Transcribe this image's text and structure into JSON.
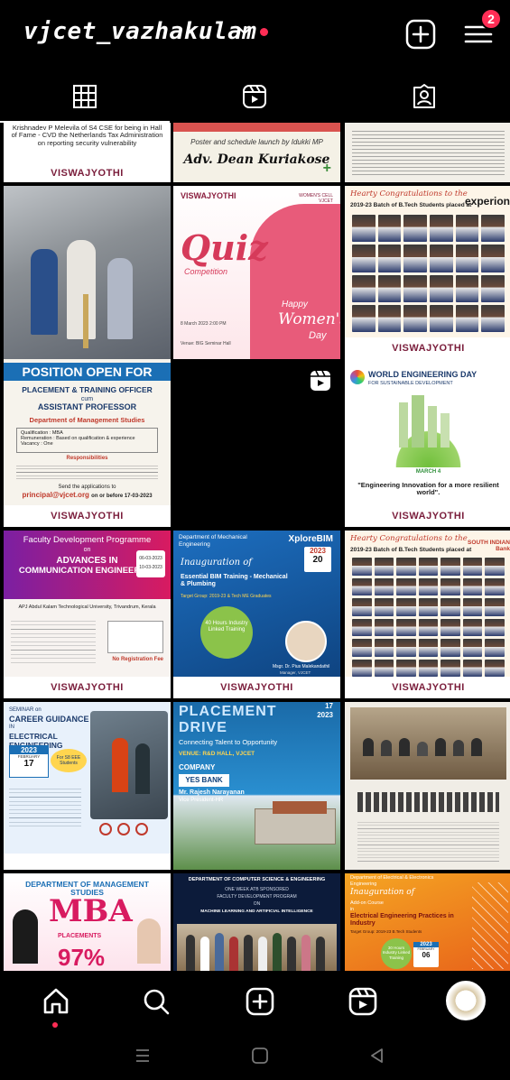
{
  "header": {
    "username": "vjcet_vazhakulam",
    "notification_count": "2",
    "accent": "#ff2d55"
  },
  "tabs": [
    {
      "name": "grid",
      "icon": "grid-icon",
      "active": true
    },
    {
      "name": "reels",
      "icon": "reels-icon",
      "active": false
    },
    {
      "name": "tagged",
      "icon": "tagged-icon",
      "active": false
    }
  ],
  "posts": {
    "p1": {
      "text1": "Krishnadev P Melevila of S4 CSE for being in Hall of Fame - CVD the Netherlands Tax Administration on reporting security vulnerability",
      "logo": "VISWAJYOTHI"
    },
    "p2": {
      "text1": "Poster and schedule launch by Idukki MP",
      "text2": "Adv. Dean Kuriakose"
    },
    "p3": {
      "text1": "Malayalam newspaper clipping"
    },
    "p4": {
      "text1": "Lamp lighting ceremony"
    },
    "p5": {
      "brand": "VISWAJYOTHI",
      "cell": "WOMEN'S CELL VJCET",
      "title": "Quiz",
      "sub": "Competition",
      "happy": "Happy",
      "womens": "Women's",
      "day": "Day",
      "date": "8 March 2023 2:00 PM",
      "venue": "Venue: BIG Seminar Hall"
    },
    "p6": {
      "title": "Hearty Congratulations to the",
      "sub": "2019-23 Batch of B.Tech Students placed at",
      "company": "experion",
      "logo": "VISWAJYOTHI"
    },
    "p7": {
      "title": "POSITION OPEN FOR",
      "role1": "PLACEMENT & TRAINING OFFICER",
      "cum": "cum",
      "role2": "ASSISTANT PROFESSOR",
      "dept": "Department of Management Studies",
      "q1": "Qualification : MBA",
      "q2": "Remuneration : Based on qualification & experience",
      "q3": "Vacancy : One",
      "resp": "Responsibilities",
      "send": "Send the applications to",
      "email": "principal@vjcet.org",
      "before": "on or before 17-03-2023",
      "logo": "VISWAJYOTHI"
    },
    "p8": {
      "text1": ""
    },
    "p9": {
      "title": "WORLD ENGINEERING DAY",
      "sub": "FOR SUSTAINABLE DEVELOPMENT",
      "date": "MARCH 4",
      "quote": "\"Engineering Innovation for a more resilient world\".",
      "logo": "VISWAJYOTHI"
    },
    "p10": {
      "top": "Faculty Development Programme",
      "on": "on",
      "title1": "ADVANCES IN",
      "title2": "COMMUNICATION ENGINEERING",
      "sponsor": "APJ Abdul Kalam Technological University, Trivandrum, Kerala",
      "d1": "06-03-2023",
      "d2": "10-03-2023",
      "fee": "No Registration Fee",
      "logo": "VISWAJYOTHI"
    },
    "p11": {
      "dept": "Department of Mechanical Engineering",
      "inaug": "Inauguration of",
      "course": "Essential BIM Training - Mechanical & Plumbing",
      "target": "Target Group: 2019-23 & Tech ME Graduates",
      "brand": "XploreBIM",
      "year": "2023",
      "date": "20",
      "hours": "40 Hours Industry Linked Training",
      "person": "Msgr. Dr. Pius Malekandathil",
      "role": "Manager, VJCET",
      "logo": "VISWAJYOTHI"
    },
    "p12": {
      "title": "Hearty Congratulations to the",
      "sub": "2019-23 Batch of B.Tech Students placed at",
      "company": "SOUTH INDIAN Bank",
      "logo": "VISWAJYOTHI"
    },
    "p13": {
      "seminar": "SEMINAR on",
      "title1": "CAREER GUIDANCE",
      "in": "IN",
      "title2": "ELECTRICAL ENGINEERING",
      "year": "2023",
      "month": "FEBRUARY",
      "date": "17",
      "for": "For S8 EEE Students"
    },
    "p14": {
      "top": "17",
      "year": "2023",
      "title1": "PLACEMENT",
      "title2": "DRIVE",
      "sub": "Connecting Talent to Opportunity",
      "venue": "VENUE: R&D HALL, VJCET",
      "company": "COMPANY",
      "bank": "YES BANK",
      "person": "Mr. Rajesh Narayanan",
      "role": "Vice President-HR"
    },
    "p15": {
      "caption": "Malayalam newspaper headline"
    },
    "p16": {
      "title": "DEPARTMENT OF MANAGEMENT STUDIES",
      "mba": "MBA",
      "place": "PLACEMENTS",
      "pct": "97%"
    },
    "p17": {
      "title": "DEPARTMENT OF COMPUTER SCIENCE & ENGINEERING",
      "sub": "ONE WEEK ATB SPONSORED",
      "fdp": "FACULTY DEVELOPMENT PROGRAM",
      "on": "ON",
      "topic": "MACHINE LEARNING AND ARTIFICIAL INTELLIGENCE"
    },
    "p18": {
      "dept": "Department of Electrical & Electronics Engineering",
      "inaug": "Inauguration of",
      "addon": "Add-on Course",
      "in": "in",
      "course": "Electrical Engineering Practices in Industry",
      "target": "Target Group: 2019-23 B.Tech Students",
      "hours": "30 Hours Industry Linked Training",
      "year": "2023",
      "month": "FEBRUARY",
      "date": "06"
    }
  },
  "bottom_nav": [
    {
      "name": "home",
      "icon": "home-icon"
    },
    {
      "name": "search",
      "icon": "search-icon"
    },
    {
      "name": "create",
      "icon": "plus-square-icon"
    },
    {
      "name": "reels",
      "icon": "reels-icon"
    },
    {
      "name": "profile",
      "icon": "profile-avatar"
    }
  ],
  "system_nav": [
    "recents-icon",
    "home-circle-icon",
    "back-icon"
  ]
}
